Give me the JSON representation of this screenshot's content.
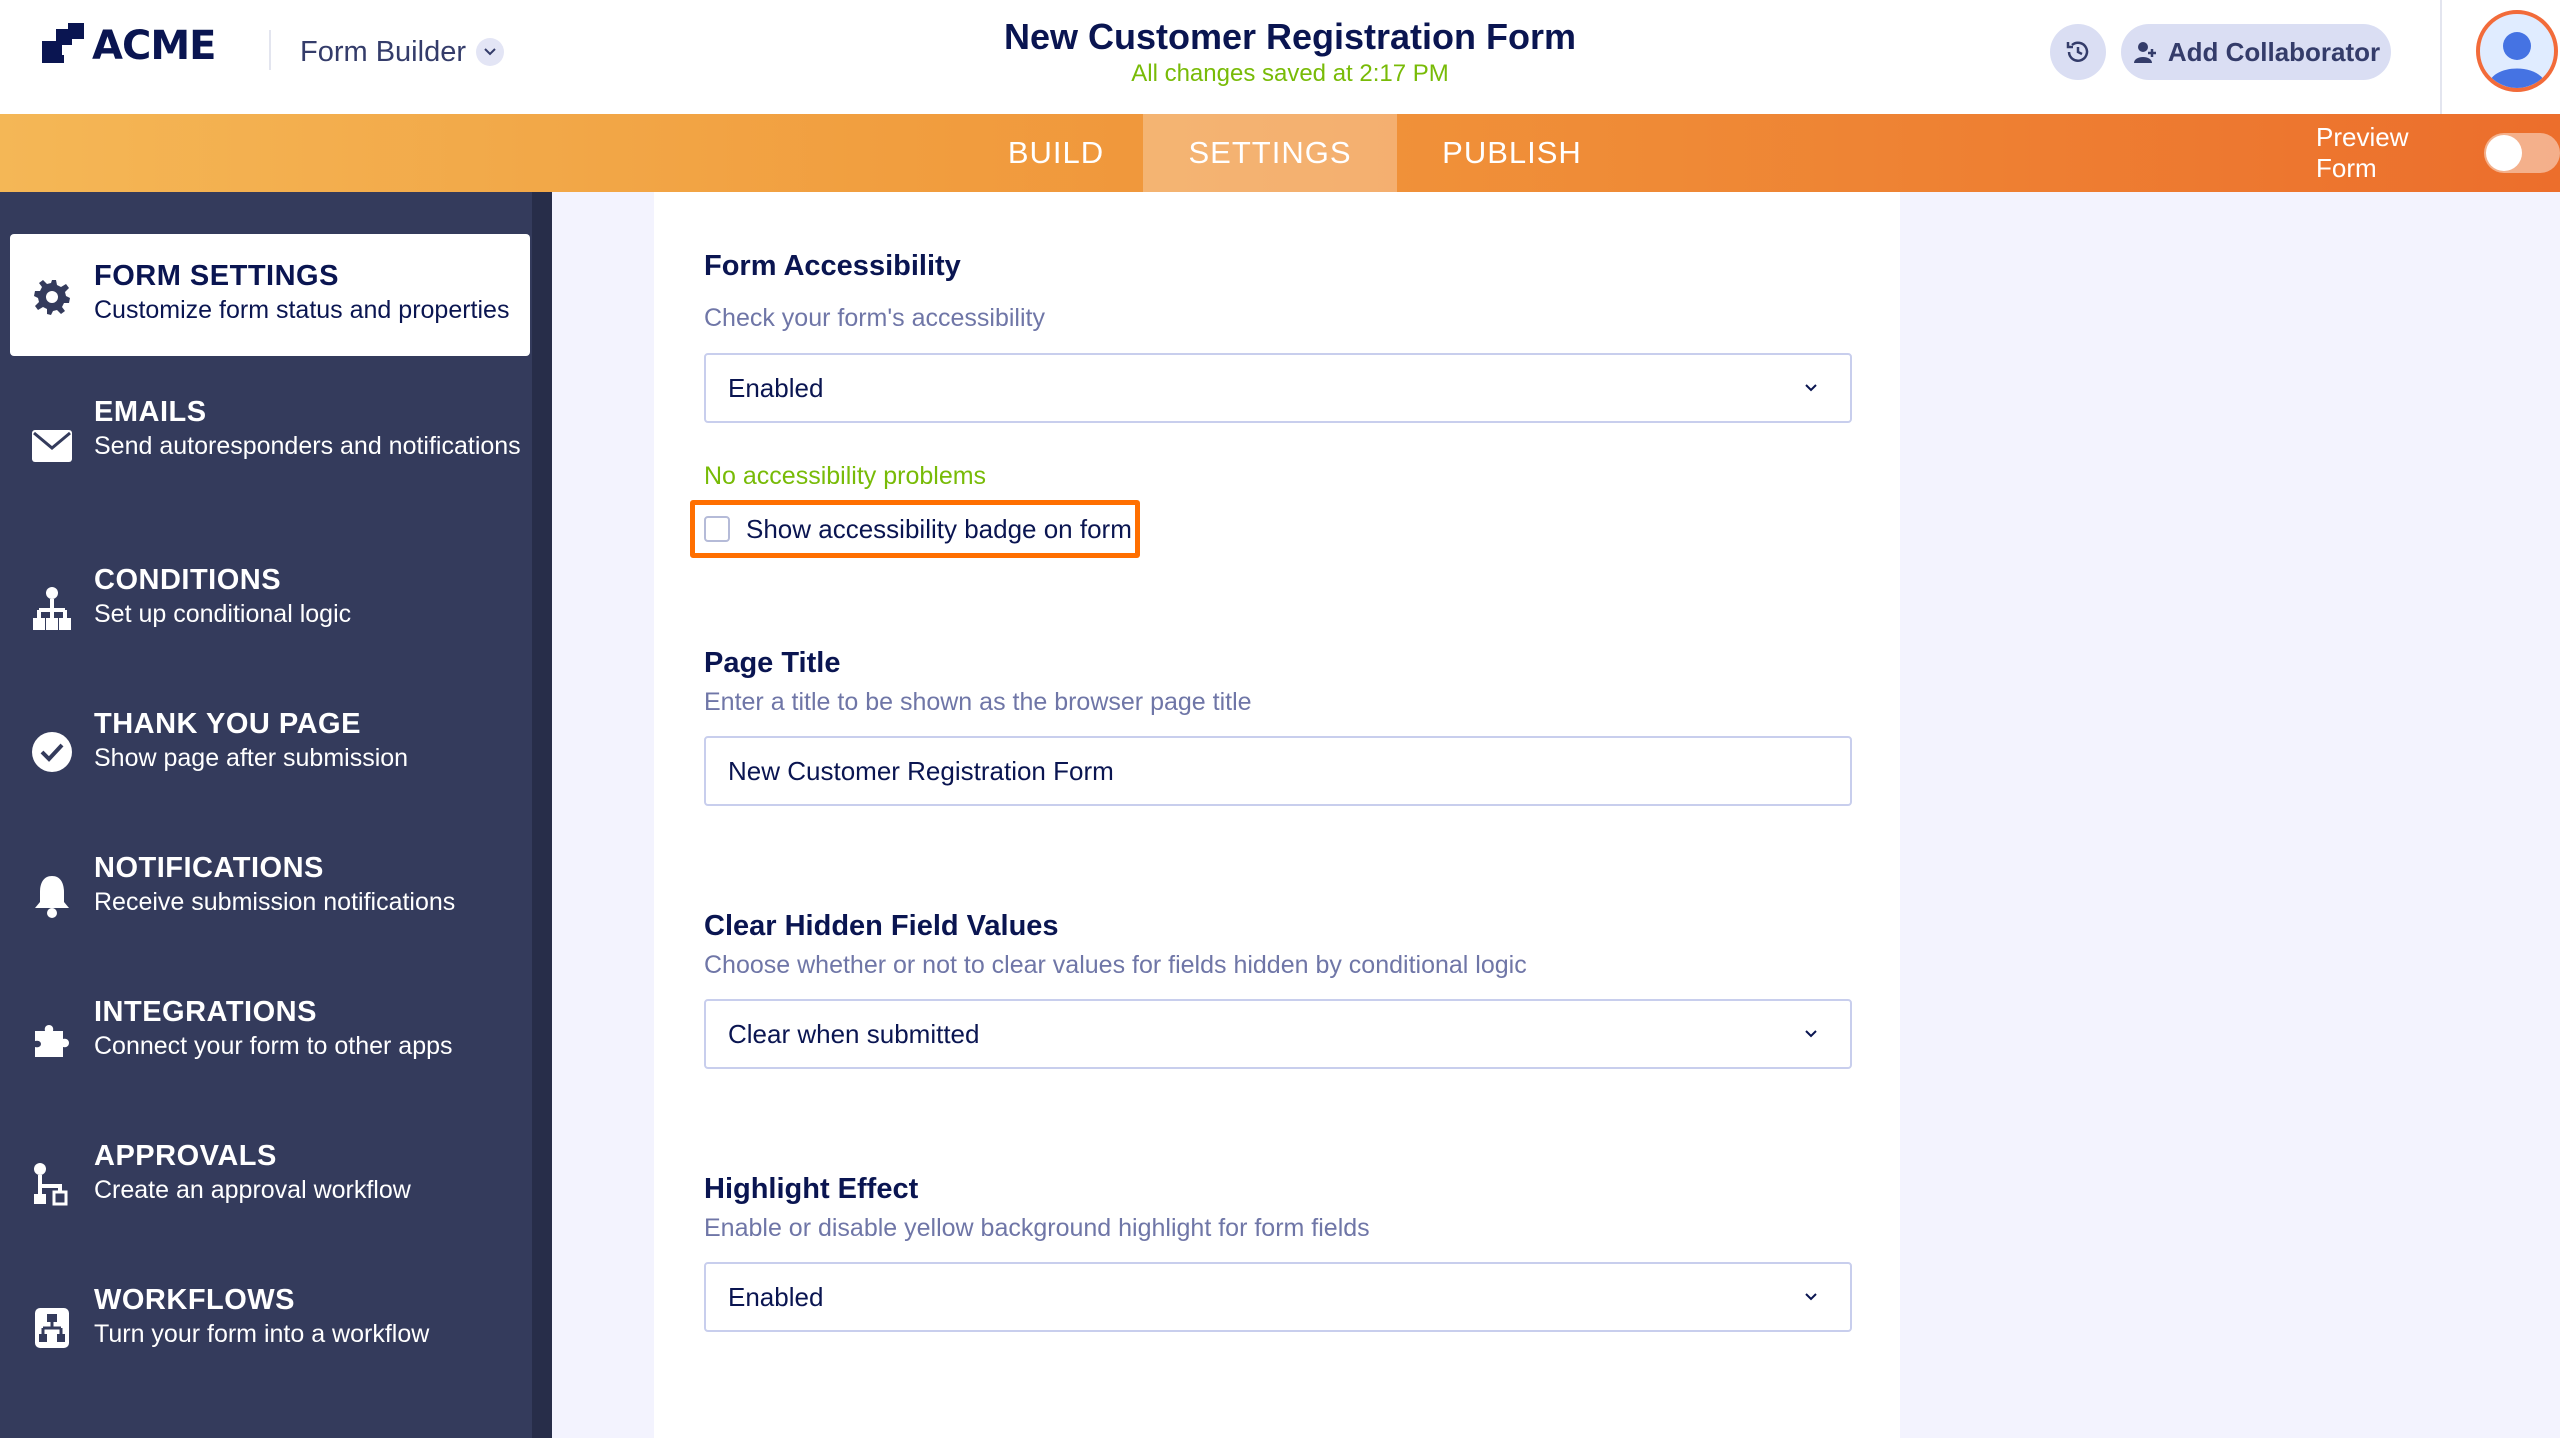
{
  "header": {
    "logo_text": "ACME",
    "app_switcher_label": "Form Builder",
    "form_title": "New Customer Registration Form",
    "save_status": "All changes saved at 2:17 PM",
    "add_collaborator_label": "Add Collaborator"
  },
  "nav": {
    "tabs": [
      {
        "label": "BUILD",
        "active": false
      },
      {
        "label": "SETTINGS",
        "active": true
      },
      {
        "label": "PUBLISH",
        "active": false
      }
    ],
    "preview_label": "Preview Form",
    "preview_on": false
  },
  "sidebar": {
    "items": [
      {
        "title": "FORM SETTINGS",
        "desc": "Customize form status and properties",
        "icon": "gear-icon",
        "active": true
      },
      {
        "title": "EMAILS",
        "desc": "Send autoresponders and notifications",
        "icon": "envelope-icon",
        "active": false
      },
      {
        "title": "CONDITIONS",
        "desc": "Set up conditional logic",
        "icon": "hierarchy-icon",
        "active": false
      },
      {
        "title": "THANK YOU PAGE",
        "desc": "Show page after submission",
        "icon": "check-circle-icon",
        "active": false
      },
      {
        "title": "NOTIFICATIONS",
        "desc": "Receive submission notifications",
        "icon": "bell-icon",
        "active": false
      },
      {
        "title": "INTEGRATIONS",
        "desc": "Connect your form to other apps",
        "icon": "puzzle-icon",
        "active": false
      },
      {
        "title": "APPROVALS",
        "desc": "Create an approval workflow",
        "icon": "approval-flow-icon",
        "active": false
      },
      {
        "title": "WORKFLOWS",
        "desc": "Turn your form into a workflow",
        "icon": "workflow-icon",
        "active": false
      }
    ]
  },
  "settings": {
    "accessibility": {
      "title": "Form Accessibility",
      "desc": "Check your form's accessibility",
      "value": "Enabled",
      "status": "No accessibility problems",
      "badge_label": "Show accessibility badge on form",
      "badge_checked": false
    },
    "page_title": {
      "title": "Page Title",
      "desc": "Enter a title to be shown as the browser page title",
      "value": "New Customer Registration Form"
    },
    "clear_hidden": {
      "title": "Clear Hidden Field Values",
      "desc": "Choose whether or not to clear values for fields hidden by conditional logic",
      "value": "Clear when submitted"
    },
    "highlight": {
      "title": "Highlight Effect",
      "desc": "Enable or disable yellow background highlight for form fields",
      "value": "Enabled"
    }
  },
  "colors": {
    "accent_orange": "#ff6f00",
    "success_green": "#78bb07",
    "sidebar_bg": "#343b5c",
    "navy_text": "#0a1551"
  }
}
